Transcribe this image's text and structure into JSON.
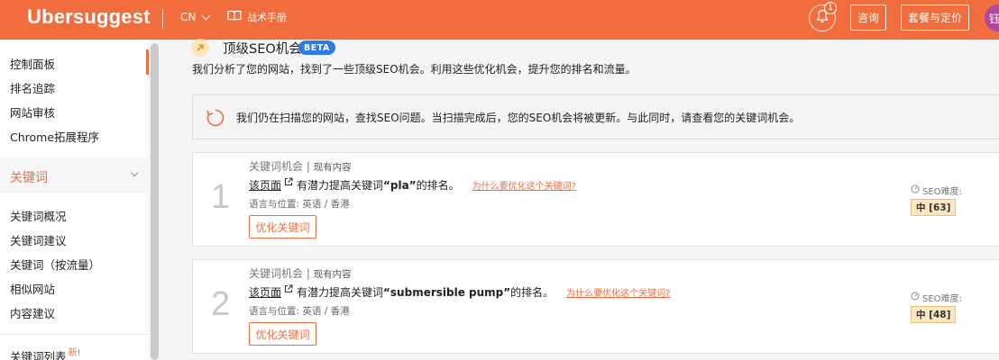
{
  "header": {
    "logo": "Ubersuggest",
    "language": "CN",
    "handbook_label": "战术手册",
    "notification_count": "1",
    "consult_label": "咨询",
    "pricing_label": "套餐与定价",
    "avatar_text": "钰",
    "brand_color": "#f26d3d"
  },
  "sidebar": {
    "items_top": [
      {
        "label": "控制面板",
        "active": true
      },
      {
        "label": "排名追踪"
      },
      {
        "label": "网站审核"
      },
      {
        "label": "Chrome拓展程序"
      }
    ],
    "section_label": "关键词",
    "items_keywords": [
      {
        "label": "关键词概况"
      },
      {
        "label": "关键词建议"
      },
      {
        "label": "关键词（按流量）"
      },
      {
        "label": "相似网站"
      },
      {
        "label": "内容建议"
      }
    ],
    "bottom_item": {
      "label": "关键词列表",
      "tag": "新!"
    }
  },
  "main": {
    "title": "顶级SEO机会",
    "beta_label": "BETA",
    "subtitle": "我们分析了您的网站，找到了一些顶级SEO机会。利用这些优化机会，提升您的排名和流量。",
    "notice": "我们仍在扫描您的网站，查找SEO问题。当扫描完成后，您的SEO机会将被更新。与此同时，请查看您的关键词机会。",
    "cards": [
      {
        "number": "1",
        "category": "关键词机会",
        "separator": " | ",
        "category_sub": "现有内容",
        "page_link": "该页面",
        "text_before": "有潜力提高关键词 ",
        "keyword": "“pla”",
        "text_after": "的排名。",
        "why_link": "为什么要优化这个关键词?",
        "location": "语言与位置:  英语 / 香港",
        "button": "优化关键词",
        "seo_label": "SEO难度:",
        "seo_value": "中 [63]"
      },
      {
        "number": "2",
        "category": "关键词机会",
        "separator": " | ",
        "category_sub": "现有内容",
        "page_link": "该页面",
        "text_before": "有潜力提高关键词 ",
        "keyword": "“submersible pump”",
        "text_after": "的排名。",
        "why_link": "为什么要优化这个关键词?",
        "location": "语言与位置:  英语 / 香港",
        "button": "优化关键词",
        "seo_label": "SEO难度:",
        "seo_value": "中 [48]"
      }
    ]
  }
}
